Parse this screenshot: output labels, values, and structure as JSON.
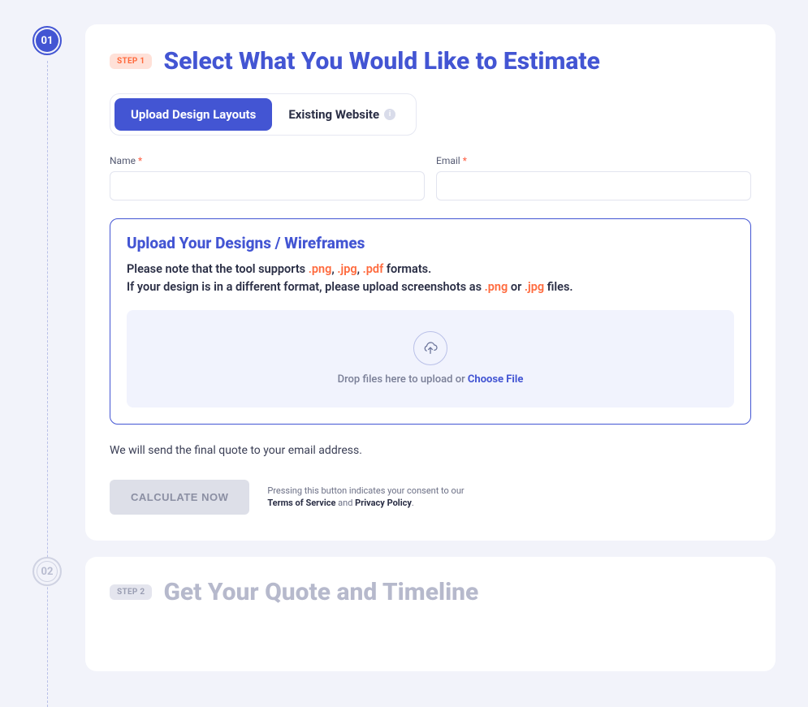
{
  "timeline": {
    "step1": "01",
    "step2": "02"
  },
  "step1": {
    "pill": "STEP 1",
    "title": "Select What You Would Like to Estimate",
    "tabs": {
      "upload": "Upload Design Layouts",
      "existing": "Existing Website"
    },
    "fields": {
      "name_label": "Name",
      "email_label": "Email",
      "required": "*"
    },
    "upload": {
      "title": "Upload Your Designs / Wireframes",
      "note_pre": "Please note that the tool supports ",
      "ext_png": ".png",
      "sep1": ", ",
      "ext_jpg": ".jpg",
      "sep2": ", ",
      "ext_pdf": ".pdf",
      "note_post": " formats.",
      "note2_pre": "If your design is in a different format, please upload screenshots as ",
      "note2_or": " or ",
      "note2_post": " files.",
      "drop_pre": "Drop files here to upload or ",
      "choose": "Choose File"
    },
    "send_note": "We will send the final quote to your email address.",
    "button": "CALCULATE NOW",
    "consent_pre": "Pressing this button indicates your consent to our ",
    "tos": "Terms of Service",
    "and": " and ",
    "privacy": "Privacy Policy",
    "dot": "."
  },
  "step2": {
    "pill": "STEP 2",
    "title": "Get Your Quote and Timeline"
  }
}
